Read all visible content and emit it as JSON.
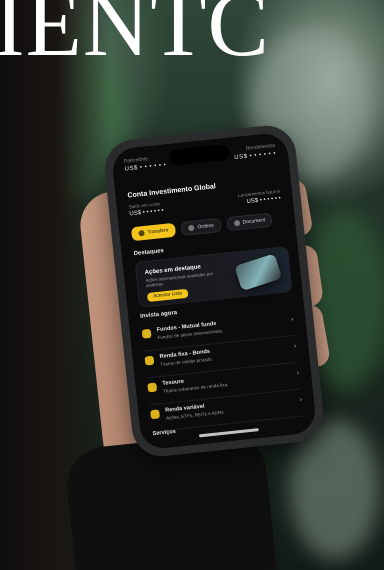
{
  "photo": {
    "headline": "IENTC"
  },
  "phone": {
    "top_left": {
      "label": "Patrimônio",
      "value": "US$ • • • • • •"
    },
    "top_right": {
      "label": "Rendimentos",
      "value": "US$ • • • • • •"
    },
    "title": "Conta Investimento Global",
    "saldo": {
      "label": "Saldo em conta",
      "value": "US$ • • • • • •"
    },
    "lancamentos": {
      "label": "Lançamentos futuros",
      "value": "US$ • • • • • •"
    },
    "pills": [
      {
        "label": "Transferir",
        "icon": "transfer-icon"
      },
      {
        "label": "Ordens",
        "icon": "orders-icon"
      },
      {
        "label": "Document",
        "icon": "document-icon"
      }
    ],
    "destaques_title": "Destaques",
    "banner": {
      "title": "Ações em destaque",
      "desc": "Ações internacionais avaliadas por analistas",
      "button": "Acessar Lista"
    },
    "invista_title": "Invista agora",
    "items": [
      {
        "title": "Fundos - Mutual funds",
        "desc": "Fundos de ativos internacionais.",
        "icon": "funds-icon"
      },
      {
        "title": "Renda fixa - Bonds",
        "desc": "Títulos de crédito privado.",
        "icon": "bonds-icon"
      },
      {
        "title": "Tesouro",
        "desc": "Títulos soberanos de renda fixa.",
        "icon": "treasury-icon"
      },
      {
        "title": "Renda variável",
        "desc": "Ações, ETFs, REITs e ADRs.",
        "icon": "stocks-icon"
      }
    ],
    "bottom_label": "Serviços",
    "accent_color": "#F2C41C"
  }
}
